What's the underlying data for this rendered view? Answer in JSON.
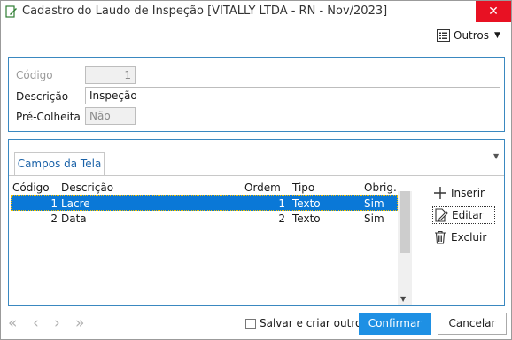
{
  "window": {
    "title": "Cadastro do Laudo de Inspeção [VITALLY LTDA - RN - Nov/2023]",
    "close_glyph": "✕"
  },
  "toolbar": {
    "outros_label": "Outros"
  },
  "form": {
    "codigo_label": "Código",
    "codigo_value": "1",
    "descricao_label": "Descrição",
    "descricao_value": "Inspeção",
    "precolheita_label": "Pré-Colheita",
    "precolheita_value": "Não"
  },
  "tabs": [
    {
      "label": "Campos da Tela"
    }
  ],
  "table": {
    "headers": [
      "Código",
      "Descrição",
      "Ordem",
      "Tipo",
      "Obrig."
    ],
    "rows": [
      {
        "codigo": "1",
        "descricao": "Lacre",
        "ordem": "1",
        "tipo": "Texto",
        "obrig": "Sim",
        "selected": true
      },
      {
        "codigo": "2",
        "descricao": "Data",
        "ordem": "2",
        "tipo": "Texto",
        "obrig": "Sim",
        "selected": false
      }
    ]
  },
  "actions": {
    "inserir": "Inserir",
    "editar": "Editar",
    "excluir": "Excluir"
  },
  "footer": {
    "nav_first": "«",
    "nav_prev": "‹",
    "nav_next": "›",
    "nav_last": "»",
    "checkbox_label": "Salvar e criar outro",
    "confirm_label": "Confirmar",
    "cancel_label": "Cancelar"
  },
  "colors": {
    "accent": "#1e90e4",
    "selection": "#0a78d7",
    "close": "#e81123",
    "panel_border": "#3a88c0"
  }
}
